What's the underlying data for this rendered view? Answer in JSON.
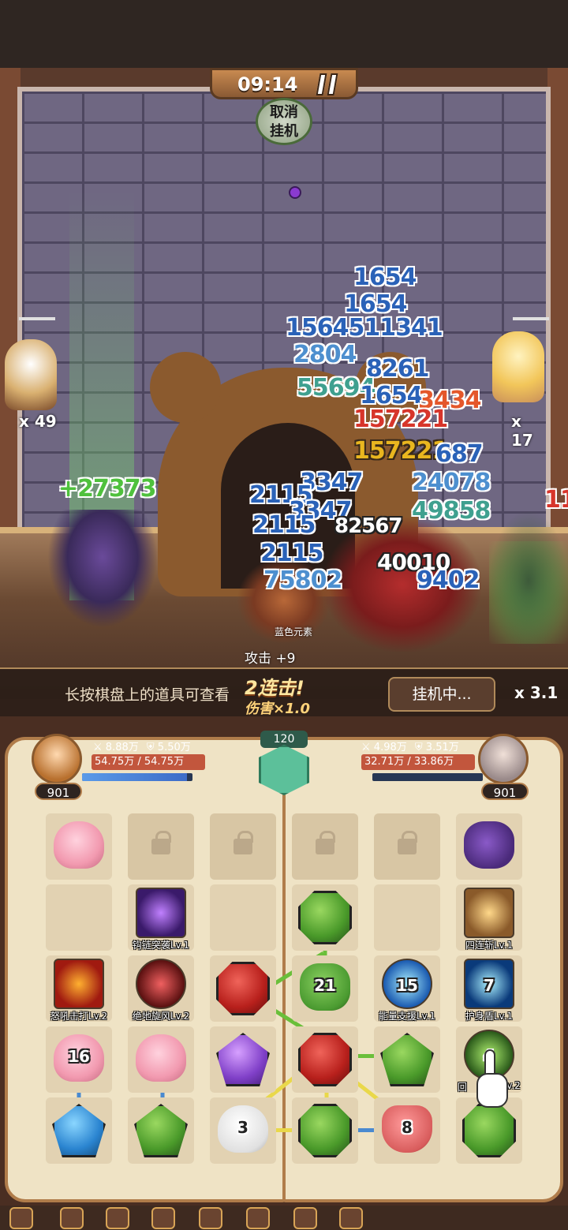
{
  "timer": "09:14",
  "cancel_idle": [
    "取消",
    "挂机"
  ],
  "allies": [
    {
      "name": "bear-pilot",
      "count": "x 49"
    },
    {
      "name": "fairy",
      "count": "x 17"
    }
  ],
  "damage_numbers": [
    {
      "text": "1654",
      "style": "blue"
    },
    {
      "text": "1654",
      "style": "blue"
    },
    {
      "text": "1564511341",
      "style": "blue"
    },
    {
      "text": "2804",
      "style": "lb"
    },
    {
      "text": "8261",
      "style": "blue"
    },
    {
      "text": "55694",
      "style": "teal"
    },
    {
      "text": "1654",
      "style": "blue"
    },
    {
      "text": "3434",
      "style": "orange"
    },
    {
      "text": "157221",
      "style": "red"
    },
    {
      "text": "157221",
      "style": "yellow"
    },
    {
      "text": "687",
      "style": "blue"
    },
    {
      "text": "+27373",
      "style": "green"
    },
    {
      "text": "3347",
      "style": "blue"
    },
    {
      "text": "24078",
      "style": "lb"
    },
    {
      "text": "2115",
      "style": "blue"
    },
    {
      "text": "3347",
      "style": "blue"
    },
    {
      "text": "49858",
      "style": "teal"
    },
    {
      "text": "2115",
      "style": "blue"
    },
    {
      "text": "82567",
      "style": "white"
    },
    {
      "text": "2115",
      "style": "blue"
    },
    {
      "text": "40010",
      "style": "white"
    },
    {
      "text": "75802",
      "style": "lb"
    },
    {
      "text": "9402",
      "style": "blue"
    },
    {
      "text": "11",
      "style": "red"
    }
  ],
  "element_label": "蓝色元素",
  "buff": "攻击 +9",
  "bottom_bar": {
    "tip": "长按棋盘上的道具可查看",
    "combo": "2连击!",
    "combo_sub": "伤害×1.0",
    "idle_button": "挂机中...",
    "speed": "x 3.1"
  },
  "player_left": {
    "attack": "8.88万",
    "defense": "5.50万",
    "hp": "54.75万 / 54.75万",
    "mp_fraction": 0.95,
    "level": "901"
  },
  "player_right": {
    "attack": "4.98万",
    "defense": "3.51万",
    "hp": "32.71万 / 33.86万",
    "mp_fraction": 0.0,
    "level": "901"
  },
  "emblem_value": "120",
  "skills": {
    "chain_assault": "钩链突袭Lv.1",
    "quad_slash": "四连斩Lv.1",
    "roar_strike": "怒吼击打Lv.2",
    "ground_whirlwind": "绝地旋风Lv.2",
    "energy_support": "能量支援Lv.1",
    "body_shield": "护身盾Lv.1",
    "regen": "回",
    "regen_tail": "v.2"
  },
  "cell_numbers": {
    "cactus": "21",
    "energy": "15",
    "shield": "7",
    "regen": "4",
    "octopus": "16",
    "ghost": "3",
    "jar": "8"
  },
  "colors": {
    "accent": "#5cc09a",
    "hp": "#c2563d",
    "mp": "#3d6cc8",
    "link": "#e9d84a"
  }
}
